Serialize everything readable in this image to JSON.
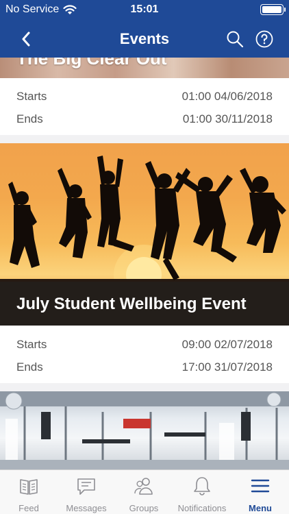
{
  "status_bar": {
    "carrier": "No Service",
    "time": "15:01"
  },
  "navbar": {
    "title": "Events"
  },
  "events": [
    {
      "title": "The Big Clear Out",
      "starts_label": "Starts",
      "starts_value": "01:00 04/06/2018",
      "ends_label": "Ends",
      "ends_value": "01:00 30/11/2018"
    },
    {
      "title": "July Student Wellbeing Event",
      "starts_label": "Starts",
      "starts_value": "09:00 02/07/2018",
      "ends_label": "Ends",
      "ends_value": "17:00 31/07/2018"
    }
  ],
  "tabbar": {
    "items": [
      {
        "label": "Feed",
        "icon": "book-icon"
      },
      {
        "label": "Messages",
        "icon": "chat-icon"
      },
      {
        "label": "Groups",
        "icon": "people-icon"
      },
      {
        "label": "Notifications",
        "icon": "bell-icon"
      },
      {
        "label": "Menu",
        "icon": "hamburger-icon"
      }
    ],
    "active": "Menu"
  },
  "colors": {
    "brand": "#1f4a97",
    "inactive": "#8e8e93",
    "background": "#f1f1f3"
  }
}
